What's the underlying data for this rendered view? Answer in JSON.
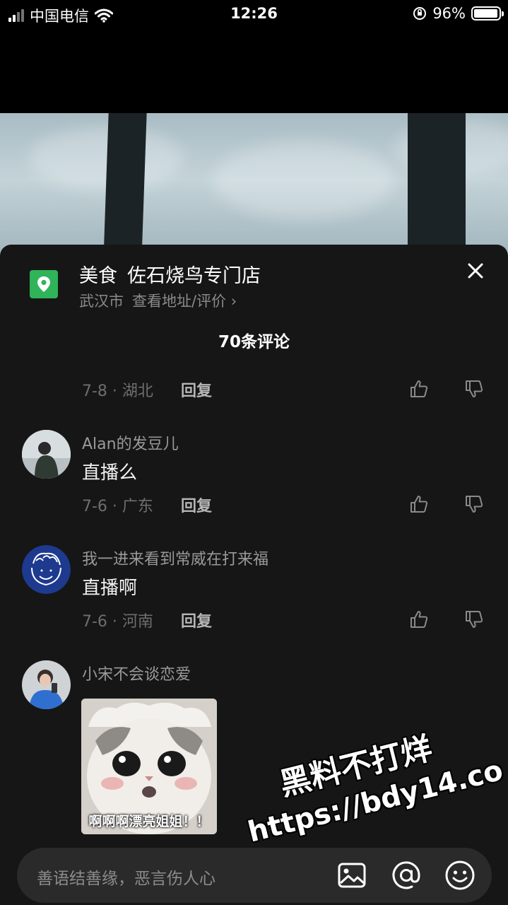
{
  "status_bar": {
    "carrier": "中国电信",
    "time": "12:26",
    "battery": "96%",
    "battery_level": 0.96
  },
  "poi": {
    "category": "美食",
    "name": "佐石烧鸟专门店",
    "city": "武汉市",
    "link": "查看地址/评价 ›"
  },
  "comments_header": "70条评论",
  "comments": [
    {
      "date": "7-8 · 湖北",
      "reply": "回复"
    },
    {
      "username": "Alan的发豆儿",
      "text": "直播么",
      "date": "7-6 · 广东",
      "reply": "回复"
    },
    {
      "username": "我一进来看到常威在打来福",
      "text": "直播啊",
      "date": "7-6 · 河南",
      "reply": "回复"
    },
    {
      "username": "小宋不会谈恋爱",
      "sticker_caption": "啊啊啊漂亮姐姐！！"
    }
  ],
  "input": {
    "placeholder": "善语结善缘，恶言伤人心"
  },
  "watermark": {
    "line1": "黑料不打烊",
    "line2": "https://bdy14.co"
  },
  "colors": {
    "sheet_bg": "#161616",
    "poi_icon": "#2fb45a",
    "input_bg": "#2a2a2a"
  }
}
